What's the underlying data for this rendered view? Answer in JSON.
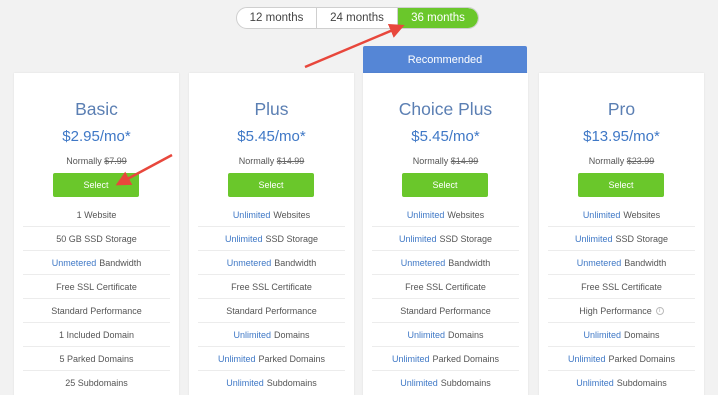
{
  "terms": {
    "t12": "12 months",
    "t24": "24 months",
    "t36": "36 months",
    "selected": "36 months"
  },
  "recommended_label": "Recommended",
  "colors": {
    "accent_green": "#6ac72b",
    "accent_blue": "#5586d6",
    "price_blue": "#3f78c6",
    "arrow_red": "#e8473c"
  },
  "select_label": "Select",
  "normally_label": "Normally",
  "plans": [
    {
      "name": "Basic",
      "price": "$2.95/mo*",
      "normal_price": "$7.99",
      "features": [
        {
          "hl": "",
          "text": "1 Website"
        },
        {
          "hl": "",
          "text": "50 GB SSD Storage"
        },
        {
          "hl": "Unmetered",
          "text": "Bandwidth"
        },
        {
          "hl": "",
          "text": "Free SSL Certificate"
        },
        {
          "hl": "",
          "text": "Standard Performance"
        },
        {
          "hl": "",
          "text": "1 Included Domain"
        },
        {
          "hl": "",
          "text": "5 Parked Domains"
        },
        {
          "hl": "",
          "text": "25 Subdomains"
        }
      ]
    },
    {
      "name": "Plus",
      "price": "$5.45/mo*",
      "normal_price": "$14.99",
      "features": [
        {
          "hl": "Unlimited",
          "text": "Websites"
        },
        {
          "hl": "Unlimited",
          "text": "SSD Storage"
        },
        {
          "hl": "Unmetered",
          "text": "Bandwidth"
        },
        {
          "hl": "",
          "text": "Free SSL Certificate"
        },
        {
          "hl": "",
          "text": "Standard Performance"
        },
        {
          "hl": "Unlimited",
          "text": "Domains"
        },
        {
          "hl": "Unlimited",
          "text": "Parked Domains"
        },
        {
          "hl": "Unlimited",
          "text": "Subdomains"
        }
      ]
    },
    {
      "name": "Choice Plus",
      "price": "$5.45/mo*",
      "normal_price": "$14.99",
      "features": [
        {
          "hl": "Unlimited",
          "text": "Websites"
        },
        {
          "hl": "Unlimited",
          "text": "SSD Storage"
        },
        {
          "hl": "Unmetered",
          "text": "Bandwidth"
        },
        {
          "hl": "",
          "text": "Free SSL Certificate"
        },
        {
          "hl": "",
          "text": "Standard Performance"
        },
        {
          "hl": "Unlimited",
          "text": "Domains"
        },
        {
          "hl": "Unlimited",
          "text": "Parked Domains"
        },
        {
          "hl": "Unlimited",
          "text": "Subdomains"
        }
      ]
    },
    {
      "name": "Pro",
      "price": "$13.95/mo*",
      "normal_price": "$23.99",
      "features": [
        {
          "hl": "Unlimited",
          "text": "Websites"
        },
        {
          "hl": "Unlimited",
          "text": "SSD Storage"
        },
        {
          "hl": "Unmetered",
          "text": "Bandwidth"
        },
        {
          "hl": "",
          "text": "Free SSL Certificate"
        },
        {
          "hl": "",
          "text": "High Performance",
          "info_icon": "info-icon"
        },
        {
          "hl": "Unlimited",
          "text": "Domains"
        },
        {
          "hl": "Unlimited",
          "text": "Parked Domains"
        },
        {
          "hl": "Unlimited",
          "text": "Subdomains"
        }
      ]
    }
  ]
}
